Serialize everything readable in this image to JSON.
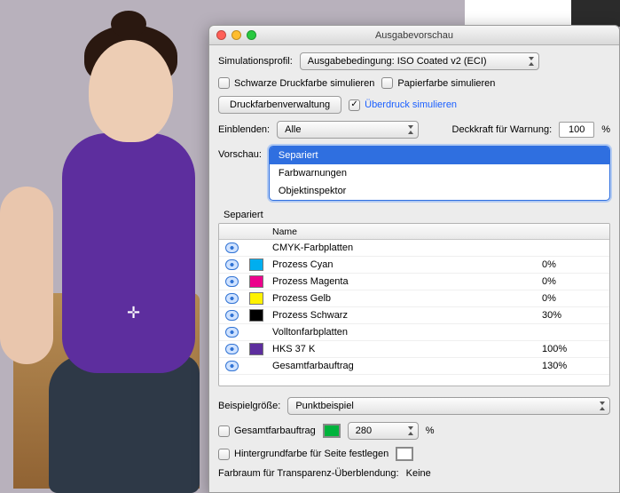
{
  "window": {
    "title": "Ausgabevorschau"
  },
  "simprofile": {
    "label": "Simulationsprofil:",
    "value": "Ausgabebedingung: ISO Coated v2 (ECI)"
  },
  "checks": {
    "black_ink": {
      "label": "Schwarze Druckfarbe simulieren",
      "on": false
    },
    "paper": {
      "label": "Papierfarbe simulieren",
      "on": false
    },
    "overprint": {
      "label": "Überdruck simulieren",
      "on": true
    }
  },
  "ink_manager_btn": "Druckfarbenverwaltung",
  "show": {
    "label": "Einblenden:",
    "value": "Alle",
    "warn_label": "Deckkraft für Warnung:",
    "warn_value": "100",
    "warn_unit": "%"
  },
  "preview": {
    "label": "Vorschau:",
    "options": [
      "Separiert",
      "Farbwarnungen",
      "Objektinspektor"
    ],
    "selected_index": 0
  },
  "separations": {
    "title": "Separiert",
    "header_name": "Name",
    "rows": [
      {
        "swatch": null,
        "name": "CMYK-Farbplatten",
        "pct": ""
      },
      {
        "swatch": "#00aeef",
        "name": "Prozess Cyan",
        "pct": "0%"
      },
      {
        "swatch": "#ec008c",
        "name": "Prozess Magenta",
        "pct": "0%"
      },
      {
        "swatch": "#fff200",
        "name": "Prozess Gelb",
        "pct": "0%"
      },
      {
        "swatch": "#000000",
        "name": "Prozess Schwarz",
        "pct": "30%"
      },
      {
        "swatch": null,
        "name": "Volltonfarbplatten",
        "pct": ""
      },
      {
        "swatch": "#5d2e9e",
        "name": "HKS 37 K",
        "pct": "100%"
      },
      {
        "swatch": null,
        "name": "Gesamtfarbauftrag",
        "pct": "130%"
      }
    ]
  },
  "sample": {
    "label": "Beispielgröße:",
    "value": "Punktbeispiel"
  },
  "tac": {
    "label": "Gesamtfarbauftrag",
    "on": false,
    "swatch": "#00b33c",
    "value": "280",
    "unit": "%"
  },
  "page_bg": {
    "label": "Hintergrundfarbe für Seite festlegen",
    "on": false,
    "swatch": "#ffffff"
  },
  "transp": {
    "label": "Farbraum für Transparenz-Überblendung:",
    "value": "Keine"
  },
  "crosshair": "✛"
}
